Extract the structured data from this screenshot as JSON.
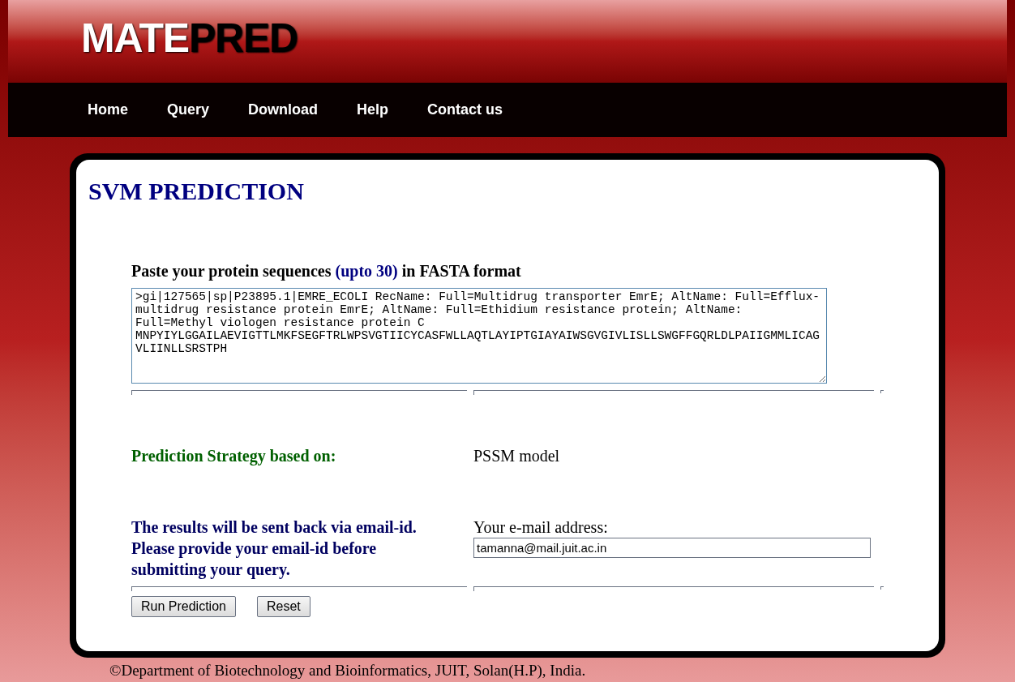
{
  "logo": [
    {
      "text": "MATE",
      "kind": "light"
    },
    {
      "text": "PRED",
      "kind": "dark"
    }
  ],
  "nav": [
    {
      "label": "Home"
    },
    {
      "label": "Query"
    },
    {
      "label": "Download"
    },
    {
      "label": "Help"
    },
    {
      "label": "Contact us"
    }
  ],
  "title": "SVM PREDICTION",
  "sequence_label": "Paste your protein sequences **(upto 30)** in FASTA format",
  "sequence_value": ">gi|127565|sp|P23895.1|EMRE_ECOLI RecName: Full=Multidrug transporter EmrE; AltName: Full=Efflux-multidrug resistance protein EmrE; AltName: Full=Ethidium resistance protein; AltName: Full=Methyl viologen resistance protein C\nMNPYIYLGGAILAEVIGTTLMKFSEGFTRLWPSVGTIICYCASFWLLAQTLAYIPTGIAYAIWSGVGIVLISLLSWGFFGQRLDLPAIIGMMLICAGVLIINLLSRSTPH",
  "strategy": {
    "label": "Prediction Strategy based on:",
    "value": "PSSM model"
  },
  "email": {
    "note": "The results will be sent back via email-id. Please provide your email-id before submitting your query.",
    "label": "Your e-mail address:",
    "value": "tamanna@mail.juit.ac.in"
  },
  "buttons": [
    "Run Prediction",
    "Reset"
  ],
  "footer": "©Department of Biotechnology and Bioinformatics, JUIT, Solan(H.P), India."
}
